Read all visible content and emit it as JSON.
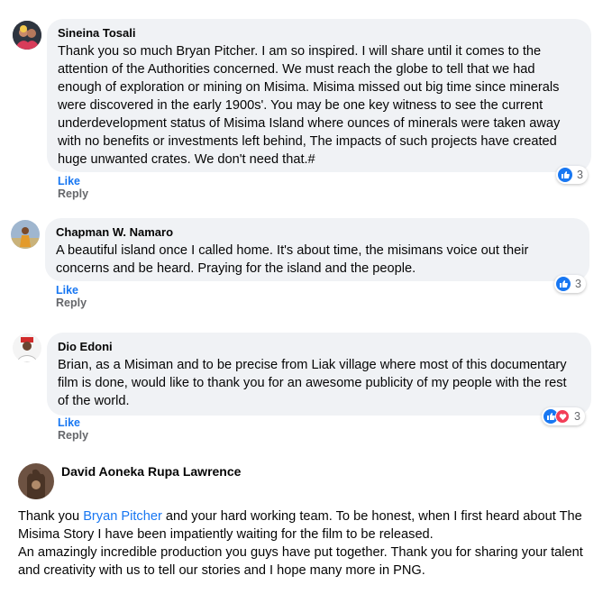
{
  "comments": [
    {
      "author": "Sineina Tosali",
      "text": "Thank you so much Bryan Pitcher. I am so inspired. I will share until it comes to the attention of the Authorities concerned. We must reach the globe to tell that we had enough of exploration or mining on Misima. Misima missed out big time since minerals were discovered in the early 1900s'. You may be one key witness to see the current underdevelopment status of Misima Island where ounces of minerals were taken away with no benefits or investments left behind, The impacts of such projects have created huge unwanted crates. We don't need that.#",
      "like_label": "Like",
      "reply_label": "Reply",
      "reaction_count": "3",
      "reactions": [
        "like-icon"
      ]
    },
    {
      "author": "Chapman W. Namaro",
      "text": "A beautiful island once I called home. It's about time, the misimans voice out their concerns and be heard. Praying for the island and the people.",
      "like_label": "Like",
      "reply_label": "Reply",
      "reaction_count": "3",
      "reactions": [
        "like-icon"
      ]
    },
    {
      "author": "Dio Edoni",
      "text": "Brian, as a Misiman and to be precise from Liak village where most of this documentary film is done, would like to thank you for an awesome publicity of my people with the rest of the world.",
      "like_label": "Like",
      "reply_label": "Reply",
      "reaction_count": "3",
      "reactions": [
        "like-icon",
        "love-icon"
      ]
    }
  ],
  "post": {
    "author": "David Aoneka Rupa Lawrence",
    "text_before_link": "Thank you ",
    "link_text": "Bryan Pitcher",
    "text_after_link": " and your hard working team. To be honest, when I first heard about The Misima Story I have been impatiently waiting for the film to be released.",
    "text_second": "An amazingly incredible production you guys have put together. Thank you for sharing your talent and creativity with us to tell our stories and I hope many more in PNG."
  },
  "colors": {
    "bubble": "#f0f2f5",
    "link": "#1877f2",
    "love": "#f33e58"
  }
}
